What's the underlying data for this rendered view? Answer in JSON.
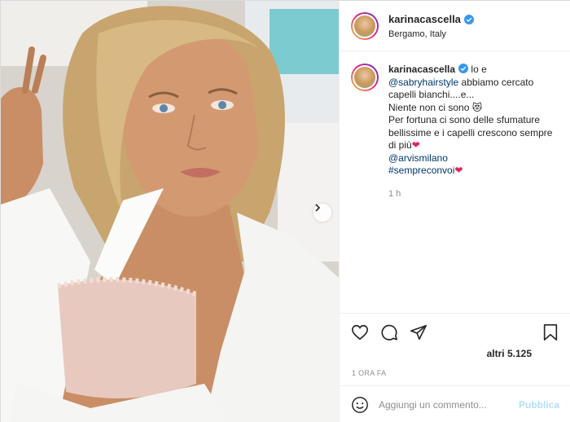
{
  "post": {
    "username": "karinacascella",
    "location": "Bergamo, Italy",
    "caption": {
      "username": "karinacascella",
      "intro": " lo e ",
      "mention1": "@sabryhairstyle",
      "line1": " abbiamo cercato capelli bianchi....e...",
      "line2": "Niente non ci sono ",
      "emoji1": "😻",
      "line3": "Per fortuna ci sono delle sfumature bellissime e i capelli crescono sempre di più",
      "heart": "❤",
      "mention2": "@arvismilano",
      "hashtag": "#sempreconvoi"
    },
    "caption_time": "1 h",
    "likes_text": "altri 5.125",
    "posted_ago": "1 ORA FA",
    "comment_placeholder": "Aggiungi un commento...",
    "publish_label": "Pubblica"
  },
  "colors": {
    "link": "#00376b",
    "verified": "#3897f0",
    "publish_disabled": "#b2dffc",
    "muted": "#8e8e8e"
  },
  "icons": {
    "verified": "verified-badge-icon",
    "like": "heart-icon",
    "comment": "comment-bubble-icon",
    "share": "paper-plane-icon",
    "save": "bookmark-icon",
    "emoji": "smiley-icon",
    "next": "chevron-right-icon"
  }
}
